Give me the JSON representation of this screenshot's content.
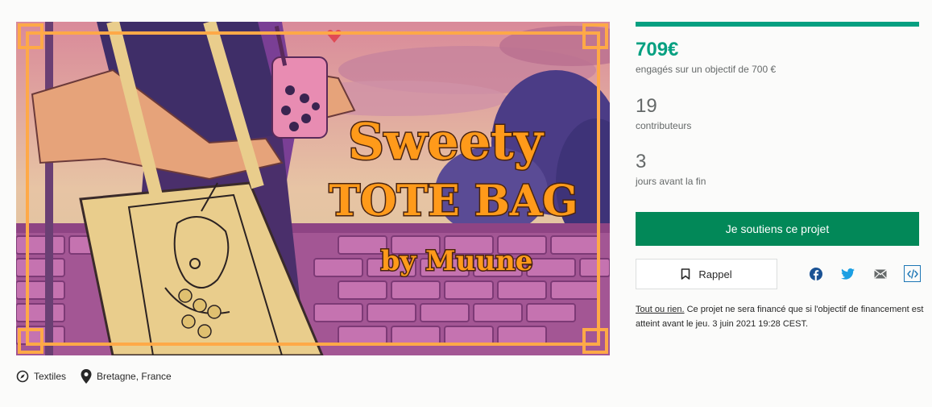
{
  "hero": {
    "title_line1": "Sweety",
    "title_line2": "TOTE BAG",
    "title_line3": "by Muune"
  },
  "meta": {
    "category": "Textiles",
    "category_icon": "compass-icon",
    "location": "Bretagne, France",
    "location_icon": "map-pin-icon"
  },
  "campaign": {
    "funded_fraction": 1.0,
    "progress_color": "#05a081",
    "pledged": "709€",
    "pledged_label": "engagés sur un objectif de 700 €",
    "backers": "19",
    "backers_label": "contributeurs",
    "days": "3",
    "days_label": "jours avant la fin"
  },
  "actions": {
    "back_label": "Je soutiens ce projet",
    "back_color": "#028858",
    "remind_label": "Rappel",
    "remind_icon": "bookmark-icon"
  },
  "share": {
    "icons": [
      "facebook-icon",
      "twitter-icon",
      "email-icon",
      "embed-icon"
    ]
  },
  "notice": {
    "link": "Tout ou rien.",
    "text": " Ce projet ne sera financé que si l'objectif de financement est atteint avant le jeu. 3 juin 2021 19:28 CEST."
  }
}
